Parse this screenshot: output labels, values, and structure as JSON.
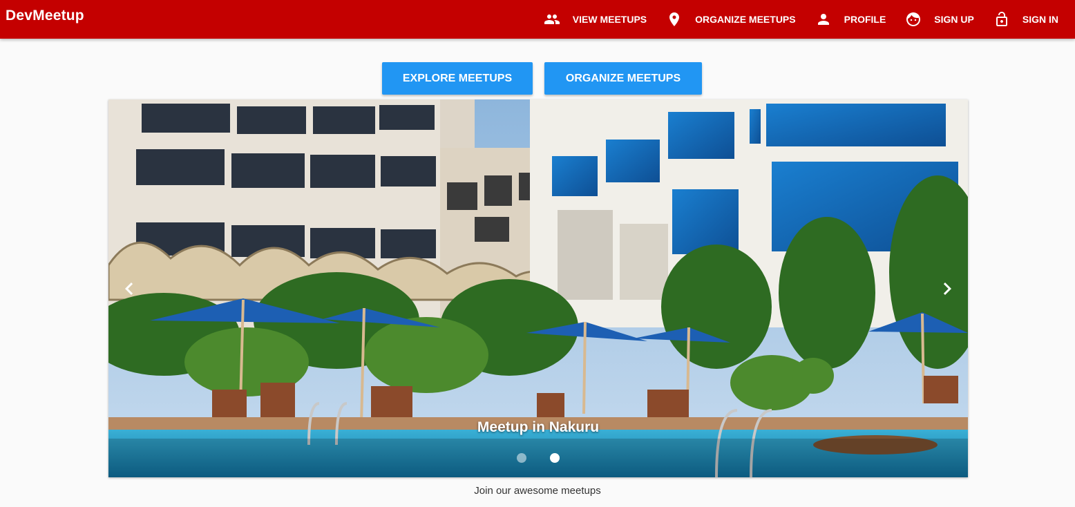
{
  "app": {
    "title": "DevMeetup"
  },
  "nav": {
    "items": [
      {
        "label": "View Meetups",
        "icon": "people-icon"
      },
      {
        "label": "Organize Meetups",
        "icon": "location-pin-icon"
      },
      {
        "label": "Profile",
        "icon": "person-icon"
      },
      {
        "label": "Sign Up",
        "icon": "face-icon"
      },
      {
        "label": "Sign In",
        "icon": "lock-open-icon"
      }
    ]
  },
  "actions": {
    "explore_label": "Explore Meetups",
    "organize_label": "Organize Meetups"
  },
  "carousel": {
    "caption": "Meetup in Nakuru",
    "slide_count": 2,
    "active_index": 1,
    "prev_icon": "chevron-left-icon",
    "next_icon": "chevron-right-icon"
  },
  "tagline": "Join our awesome meetups",
  "colors": {
    "toolbar": "#c40000",
    "button": "#2196f3",
    "background": "#fafafa"
  }
}
